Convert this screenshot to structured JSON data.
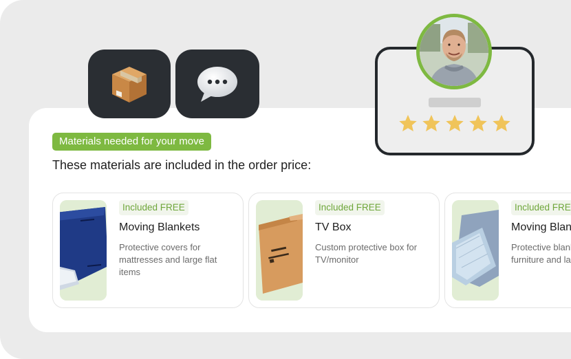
{
  "icons": {
    "box": "package-icon",
    "chat": "speech-bubble-icon"
  },
  "section": {
    "tag": "Materials needed for your move",
    "heading": "These materials are included in the order price:"
  },
  "cards": [
    {
      "badge": "Included FREE",
      "title": "Moving Blankets",
      "description": "Protective covers for mattresses and large flat items"
    },
    {
      "badge": "Included FREE",
      "title": "TV Box",
      "description": "Custom protective box for TV/monitor"
    },
    {
      "badge": "Included FREE",
      "title": "Moving Blankets",
      "description": "Protective blankets for furniture and large items"
    }
  ],
  "review": {
    "rating": 5,
    "max_rating": 5
  },
  "colors": {
    "accent": "#7eb941",
    "dark_tile": "#2a2e33",
    "star": "#f0c45a",
    "badge_text": "#6ea63a"
  }
}
